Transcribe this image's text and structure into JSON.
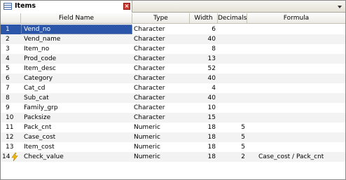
{
  "panel": {
    "title": "Items",
    "icon": "table-icon",
    "close_icon": "close-icon",
    "menu_icon": "chevron-down-icon"
  },
  "columns": {
    "num": "",
    "field_name": "Field Name",
    "type": "Type",
    "width": "Width",
    "decimals": "Decimals",
    "formula": "Formula"
  },
  "rows": [
    {
      "num": "1",
      "name": "Vend_no",
      "type": "Character",
      "width": "6",
      "decimals": "",
      "formula": "",
      "selected": true
    },
    {
      "num": "2",
      "name": "Vend_name",
      "type": "Character",
      "width": "40",
      "decimals": "",
      "formula": ""
    },
    {
      "num": "3",
      "name": "Item_no",
      "type": "Character",
      "width": "8",
      "decimals": "",
      "formula": ""
    },
    {
      "num": "4",
      "name": "Prod_code",
      "type": "Character",
      "width": "13",
      "decimals": "",
      "formula": ""
    },
    {
      "num": "5",
      "name": "Item_desc",
      "type": "Character",
      "width": "52",
      "decimals": "",
      "formula": ""
    },
    {
      "num": "6",
      "name": "Category",
      "type": "Character",
      "width": "40",
      "decimals": "",
      "formula": ""
    },
    {
      "num": "7",
      "name": "Cat_cd",
      "type": "Character",
      "width": "4",
      "decimals": "",
      "formula": ""
    },
    {
      "num": "8",
      "name": "Sub_cat",
      "type": "Character",
      "width": "40",
      "decimals": "",
      "formula": ""
    },
    {
      "num": "9",
      "name": "Family_grp",
      "type": "Character",
      "width": "10",
      "decimals": "",
      "formula": ""
    },
    {
      "num": "10",
      "name": "Packsize",
      "type": "Character",
      "width": "15",
      "decimals": "",
      "formula": ""
    },
    {
      "num": "11",
      "name": "Pack_cnt",
      "type": "Numeric",
      "width": "18",
      "decimals": "5",
      "formula": ""
    },
    {
      "num": "12",
      "name": "Case_cost",
      "type": "Numeric",
      "width": "18",
      "decimals": "5",
      "formula": ""
    },
    {
      "num": "13",
      "name": "Item_cost",
      "type": "Numeric",
      "width": "18",
      "decimals": "5",
      "formula": ""
    },
    {
      "num": "14",
      "name": "Check_value",
      "type": "Numeric",
      "width": "18",
      "decimals": "2",
      "formula": "Case_cost / Pack_cnt",
      "icon": "lightning-bolt-icon"
    }
  ],
  "colors": {
    "selection": "#2a55a8",
    "alt_row": "#f3f3f3",
    "close": "#cf3c33",
    "bolt": "#f2b90c"
  }
}
